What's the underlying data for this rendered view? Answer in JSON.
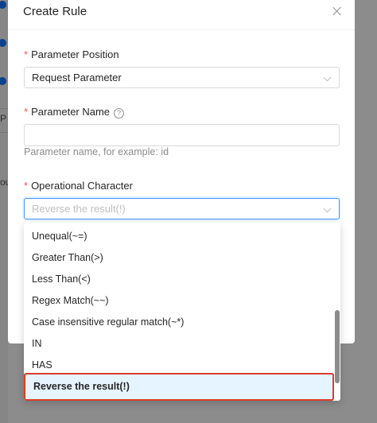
{
  "modal": {
    "title": "Create Rule",
    "close_icon": "close-icon"
  },
  "background_fragments": {
    "p_letter": "P",
    "ou_letters": "ou"
  },
  "form": {
    "position": {
      "required_mark": "*",
      "label": "Parameter Position",
      "value": "Request Parameter"
    },
    "name": {
      "required_mark": "*",
      "label": "Parameter Name",
      "help_icon": "?",
      "value": "",
      "hint": "Parameter name, for example: id"
    },
    "operator": {
      "required_mark": "*",
      "label": "Operational Character",
      "value": "Reverse the result(!)"
    }
  },
  "dropdown": {
    "options": [
      "Unequal(~=)",
      "Greater Than(>)",
      "Less Than(<)",
      "Regex Match(~~)",
      "Case insensitive regular match(~*)",
      "IN",
      "HAS",
      "Reverse the result(!)"
    ],
    "selected": "Reverse the result(!)"
  },
  "colors": {
    "accent": "#1677ff",
    "required": "#ff4d4f",
    "highlight_border": "#d93d2d",
    "selected_bg": "#e6f4ff"
  }
}
